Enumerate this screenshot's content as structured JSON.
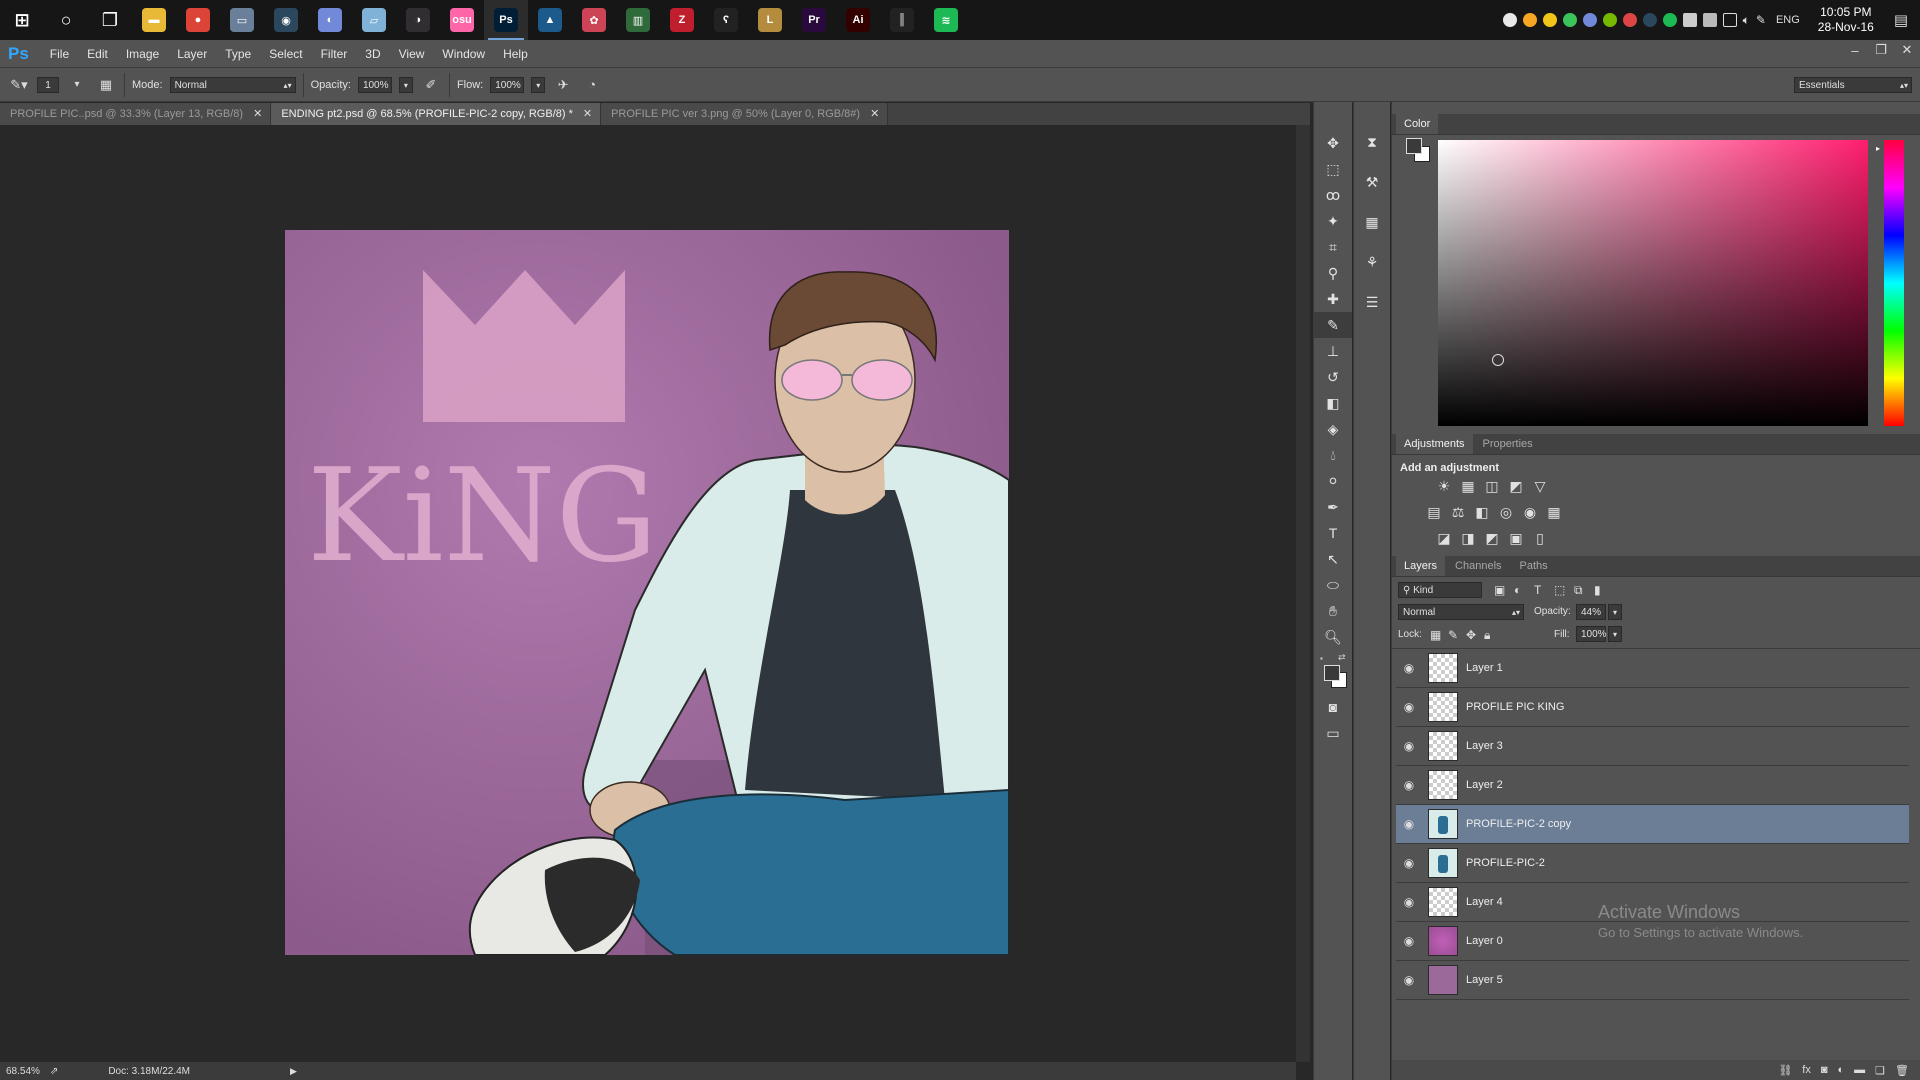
{
  "taskbar": {
    "apps": [
      {
        "name": "windows-start",
        "glyph": "⊞",
        "color": "#161616"
      },
      {
        "name": "cortana",
        "glyph": "○",
        "color": "#161616"
      },
      {
        "name": "task-view",
        "glyph": "❐",
        "color": "#161616"
      },
      {
        "name": "file-explorer",
        "glyph": "▬",
        "color": "#e8b936"
      },
      {
        "name": "chrome",
        "glyph": "●",
        "color": "#db4437"
      },
      {
        "name": "folder-app",
        "glyph": "▭",
        "color": "#6a7f9a"
      },
      {
        "name": "steam",
        "glyph": "◉",
        "color": "#2a475e"
      },
      {
        "name": "discord",
        "glyph": "◐",
        "color": "#7289da"
      },
      {
        "name": "notepad-app",
        "glyph": "▱",
        "color": "#7fb2d6"
      },
      {
        "name": "obs",
        "glyph": "◑",
        "color": "#302e31"
      },
      {
        "name": "osu",
        "glyph": "osu",
        "color": "#ff66aa"
      },
      {
        "name": "photoshop",
        "glyph": "Ps",
        "color": "#001e36"
      },
      {
        "name": "blue-app",
        "glyph": "▲",
        "color": "#1c5a8c"
      },
      {
        "name": "paint-app",
        "glyph": "✿",
        "color": "#cc4455"
      },
      {
        "name": "chart-app",
        "glyph": "▥",
        "color": "#2f6a3a"
      },
      {
        "name": "filezilla",
        "glyph": "Z",
        "color": "#bf1e2d"
      },
      {
        "name": "dark-app",
        "glyph": "ʕ",
        "color": "#222222"
      },
      {
        "name": "league",
        "glyph": "L",
        "color": "#b48c3e"
      },
      {
        "name": "premiere",
        "glyph": "Pr",
        "color": "#2a0a3d"
      },
      {
        "name": "illustrator",
        "glyph": "Ai",
        "color": "#330000"
      },
      {
        "name": "equalizer",
        "glyph": "║",
        "color": "#222222"
      },
      {
        "name": "spotify",
        "glyph": "≋",
        "color": "#1db954"
      }
    ],
    "active_app": "Ps",
    "language": "ENG",
    "time": "10:05 PM",
    "date": "28-Nov-16"
  },
  "menubar": {
    "logo": "Ps",
    "items": [
      "File",
      "Edit",
      "Image",
      "Layer",
      "Type",
      "Select",
      "Filter",
      "3D",
      "View",
      "Window",
      "Help"
    ]
  },
  "options": {
    "brush_size": "1",
    "mode_label": "Mode:",
    "mode_value": "Normal",
    "opacity_label": "Opacity:",
    "opacity_value": "100%",
    "flow_label": "Flow:",
    "flow_value": "100%",
    "workspace": "Essentials"
  },
  "tabs": [
    {
      "label": "PROFILE PIC..psd @ 33.3% (Layer 13, RGB/8)",
      "active": false
    },
    {
      "label": "ENDING pt2.psd @ 68.5% (PROFILE-PIC-2 copy, RGB/8) *",
      "active": true
    },
    {
      "label": "PROFILE PIC ver 3.png @ 50% (Layer 0, RGB/8#)",
      "active": false
    }
  ],
  "canvas": {
    "title_text": "KiNG",
    "colors": {
      "bg": "#9b6a9a",
      "crown": "#d8a0c4",
      "text": "#e2b0d0",
      "jacket": "#d9ece9",
      "shirt": "#2f363d",
      "jeans": "#2a6f93",
      "hair": "#6b4a35",
      "skin": "#dbbfa6",
      "glasses": "#f4b8d8"
    }
  },
  "status": {
    "zoom": "68.54%",
    "doc": "Doc: 3.18M/22.4M"
  },
  "color_panel": {
    "tab": "Color",
    "fg": "#3a3a3a",
    "bg": "#ffffff",
    "hue_color": "#ff1e6e"
  },
  "adjustments_panel": {
    "tabs": [
      "Adjustments",
      "Properties"
    ],
    "heading": "Add an adjustment",
    "row1": [
      "☀",
      "▦",
      "◫",
      "◩",
      "▽"
    ],
    "row2": [
      "▤",
      "⚖",
      "◧",
      "◎",
      "◉",
      "▦"
    ],
    "row3": [
      "◪",
      "◨",
      "◩",
      "▣",
      "▯"
    ]
  },
  "layers_panel": {
    "tabs": [
      "Layers",
      "Channels",
      "Paths"
    ],
    "filter": "Kind",
    "blend_mode": "Normal",
    "opacity_label": "Opacity:",
    "opacity_value": "44%",
    "lock_label": "Lock:",
    "fill_label": "Fill:",
    "fill_value": "100%",
    "layers": [
      {
        "name": "Layer 1",
        "selected": false,
        "thumb": "transparent"
      },
      {
        "name": "PROFILE PIC KING",
        "selected": false,
        "thumb": "transparent"
      },
      {
        "name": "Layer 3",
        "selected": false,
        "thumb": "transparent"
      },
      {
        "name": "Layer 2",
        "selected": false,
        "thumb": "transparent"
      },
      {
        "name": "PROFILE-PIC-2 copy",
        "selected": true,
        "thumb": "figure"
      },
      {
        "name": "PROFILE-PIC-2",
        "selected": false,
        "thumb": "figure"
      },
      {
        "name": "Layer 4",
        "selected": false,
        "thumb": "transparent"
      },
      {
        "name": "Layer 0",
        "selected": false,
        "thumb": "magenta"
      },
      {
        "name": "Layer 5",
        "selected": false,
        "thumb": "mauve"
      }
    ]
  },
  "watermark": {
    "title": "Activate Windows",
    "subtitle": "Go to Settings to activate Windows."
  }
}
